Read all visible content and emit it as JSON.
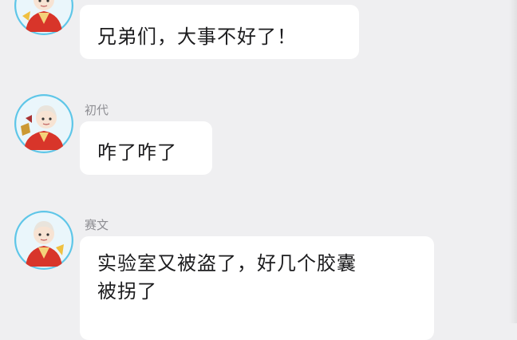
{
  "chat": {
    "messages": [
      {
        "sender": "",
        "avatar_icon": "anime-character-avatar-icon",
        "lines": [
          "兄弟们，大事不好了！"
        ]
      },
      {
        "sender": "初代",
        "avatar_icon": "anime-character-avatar-icon",
        "lines": [
          "咋了咋了"
        ]
      },
      {
        "sender": "赛文",
        "avatar_icon": "anime-character-avatar-icon",
        "lines": [
          "实验室又被盗了，好几个胶囊",
          "被拐了"
        ]
      }
    ]
  },
  "colors": {
    "background": "#efeff1",
    "bubble": "#ffffff",
    "avatar_ring": "#5ec6e8",
    "avatar_robe": "#d8352a",
    "sender_name": "#8e8e93"
  }
}
